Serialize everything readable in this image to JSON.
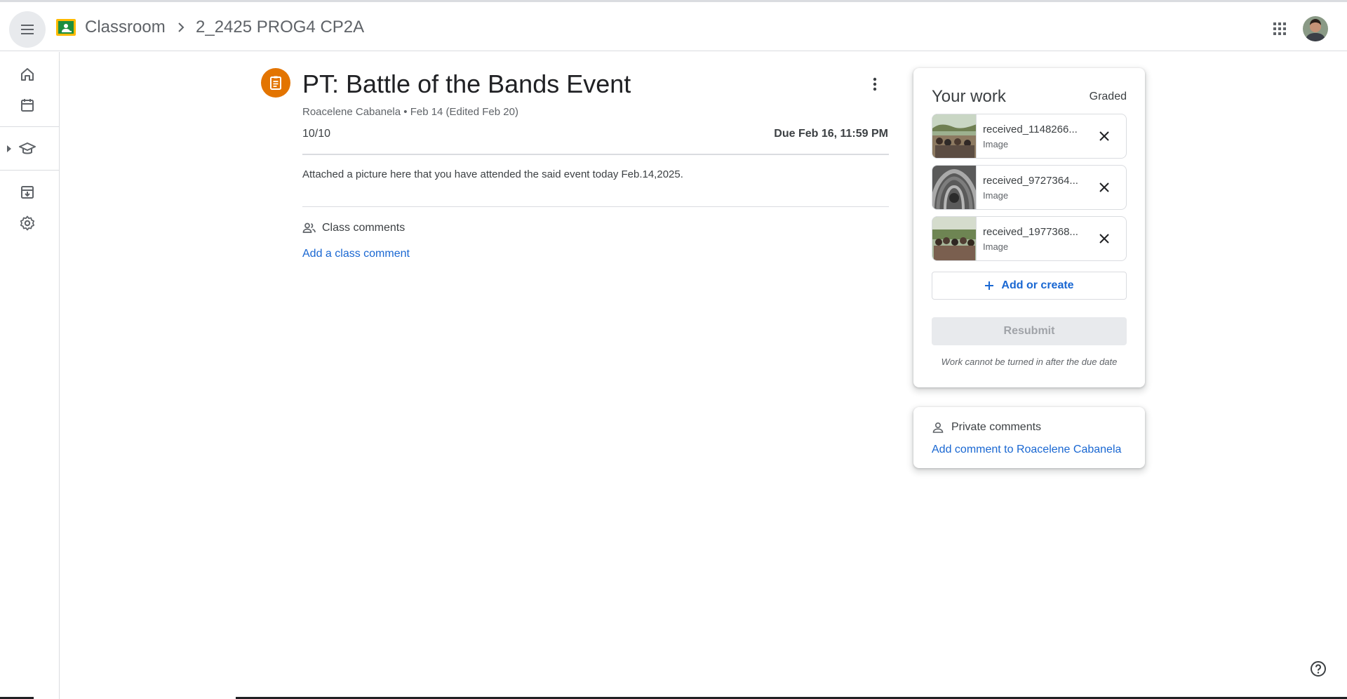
{
  "header": {
    "app_name": "Classroom",
    "class_name": "2_2425 PROG4 CP2A"
  },
  "assignment": {
    "title": "PT: Battle of the Bands Event",
    "meta": "Roacelene Cabanela • Feb 14 (Edited Feb 20)",
    "points": "10/10",
    "due": "Due Feb 16, 11:59 PM",
    "instructions": "Attached a picture here that you have attended the said event today Feb.14,2025.",
    "class_comments_label": "Class comments",
    "add_class_comment": "Add a class comment"
  },
  "your_work": {
    "title": "Your work",
    "status": "Graded",
    "attachments": [
      {
        "name": "received_1148266...",
        "type": "Image"
      },
      {
        "name": "received_9727364...",
        "type": "Image"
      },
      {
        "name": "received_1977368...",
        "type": "Image"
      }
    ],
    "add_or_create": "Add or create",
    "resubmit": "Resubmit",
    "note": "Work cannot be turned in after the due date"
  },
  "private_comments": {
    "label": "Private comments",
    "add": "Add comment to Roacelene Cabanela"
  },
  "colors": {
    "accent_blue": "#1967d2",
    "assignment_orange": "#e37400",
    "divider": "#dadce0"
  },
  "icons": [
    "menu-icon",
    "classroom-logo-icon",
    "chevron-right-icon",
    "apps-grid-icon",
    "home-icon",
    "calendar-icon",
    "caret-right-icon",
    "graduation-cap-icon",
    "archive-icon",
    "settings-icon",
    "assignment-icon",
    "more-vert-icon",
    "people-icon",
    "close-icon",
    "plus-icon",
    "person-icon",
    "help-icon"
  ]
}
